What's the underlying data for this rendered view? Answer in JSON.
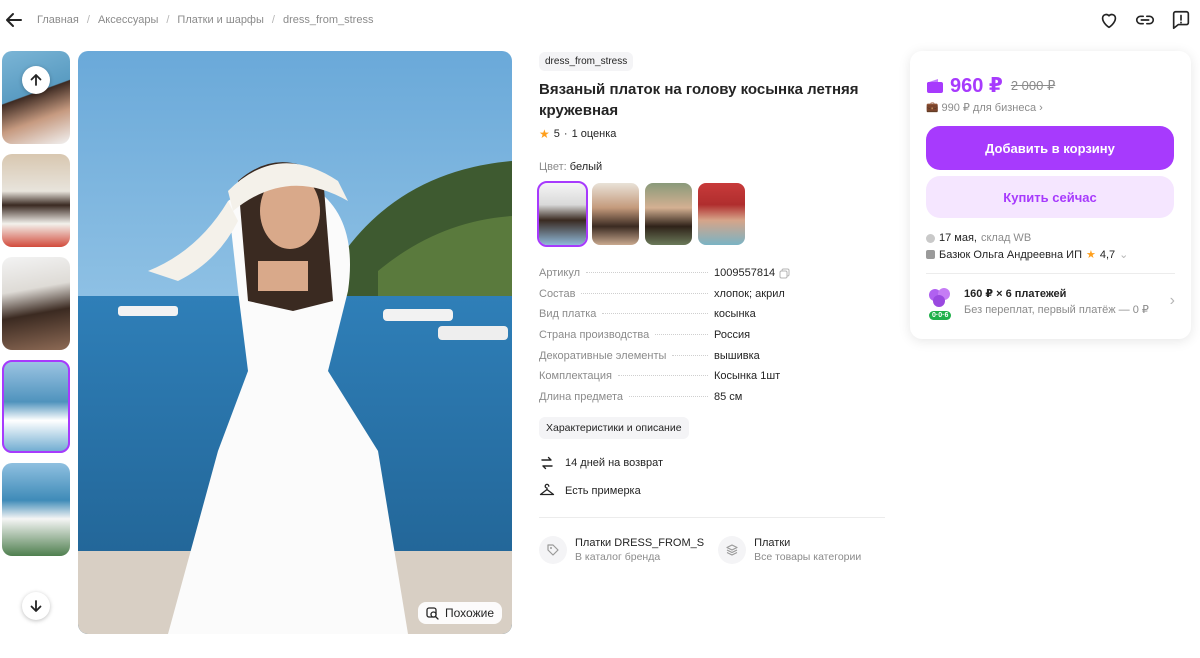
{
  "breadcrumb": [
    "Главная",
    "Аксессуары",
    "Платки и шарфы",
    "dress_from_stress"
  ],
  "icons": {
    "back": "arrow-left-icon",
    "favorite": "heart-icon",
    "share": "link-icon",
    "report": "report-icon"
  },
  "gallery": {
    "similar_label": "Похожие",
    "active_thumb_index": 3
  },
  "product": {
    "brand": "dress_from_stress",
    "title": "Вязаный платок на голову косынка летняя кружевная",
    "rating": "5",
    "reviews": "1 оценка",
    "color_label": "Цвет:",
    "color_value": "белый",
    "specs": [
      {
        "key": "Артикул",
        "value": "1009557814"
      },
      {
        "key": "Состав",
        "value": "хлопок; акрил"
      },
      {
        "key": "Вид платка",
        "value": "косынка"
      },
      {
        "key": "Страна производства",
        "value": "Россия"
      },
      {
        "key": "Декоративные элементы",
        "value": "вышивка"
      },
      {
        "key": "Комплектация",
        "value": "Косынка 1шт"
      },
      {
        "key": "Длина предмета",
        "value": "85 см"
      }
    ],
    "desc_button": "Характеристики и описание",
    "features": [
      "14 дней на возврат",
      "Есть примерка"
    ],
    "categories": [
      {
        "title": "Платки DRESS_FROM_S",
        "sub": "В каталог бренда"
      },
      {
        "title": "Платки",
        "sub": "Все товары категории"
      }
    ]
  },
  "buybox": {
    "price": "960 ₽",
    "old_price": "2 000 ₽",
    "business_price": "990 ₽ для бизнеса",
    "cart_button": "Добавить в корзину",
    "buy_button": "Купить сейчас",
    "delivery_date": "17 мая,",
    "delivery_place": "склад WB",
    "seller": "Базюк Ольга Андреевна ИП",
    "seller_rating": "4,7",
    "installment_title": "160 ₽ × 6 платежей",
    "installment_sub": "Без переплат, первый платёж — 0 ₽",
    "installment_badge": "0·0·6"
  },
  "colors": {
    "accent": "#a73afd",
    "accent_light": "#f5e6ff",
    "text": "#242424",
    "muted": "#8b8b8b",
    "star": "#ff9f1c"
  }
}
